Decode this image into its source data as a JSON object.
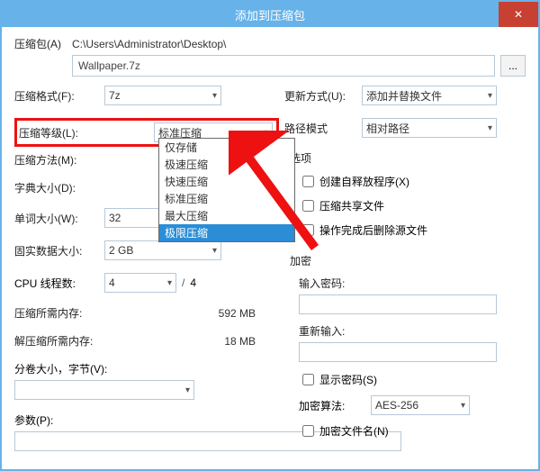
{
  "window": {
    "title": "添加到压缩包"
  },
  "archive": {
    "label": "压缩包(A)",
    "path": "C:\\Users\\Administrator\\Desktop\\",
    "file": "Wallpaper.7z",
    "browse": "..."
  },
  "left": {
    "format": {
      "label": "压缩格式(F):",
      "value": "7z"
    },
    "level": {
      "label": "压缩等级(L):",
      "value": "标准压缩",
      "options": [
        "仅存储",
        "极速压缩",
        "快速压缩",
        "标准压缩",
        "最大压缩",
        "极限压缩"
      ],
      "selected_index": 5
    },
    "method": {
      "label": "压缩方法(M):",
      "value": ""
    },
    "dict": {
      "label": "字典大小(D):",
      "value": ""
    },
    "word": {
      "label": "单词大小(W):",
      "value": "32"
    },
    "solid": {
      "label": "固实数据大小:",
      "value": "2 GB"
    },
    "cpu": {
      "label": "CPU 线程数:",
      "value": "4",
      "total": "4"
    },
    "mem_compress": {
      "label": "压缩所需内存:",
      "value": "592 MB"
    },
    "mem_decompress": {
      "label": "解压缩所需内存:",
      "value": "18 MB"
    },
    "split": {
      "label": "分卷大小，字节(V):",
      "value": ""
    },
    "params": {
      "label": "参数(P):",
      "value": ""
    }
  },
  "right": {
    "update": {
      "label": "更新方式(U):",
      "value": "添加并替换文件"
    },
    "pathmode": {
      "label": "路径模式",
      "value": "相对路径"
    },
    "options_title": "选项",
    "opt_sfx": {
      "label": "创建自释放程序(X)",
      "checked": false
    },
    "opt_share": {
      "label": "压缩共享文件",
      "checked": false
    },
    "opt_delete": {
      "label": "操作完成后删除源文件",
      "checked": false
    },
    "enc_title": "加密",
    "pw": {
      "label": "输入密码:",
      "value": ""
    },
    "pw2": {
      "label": "重新输入:",
      "value": ""
    },
    "showpw": {
      "label": "显示密码(S)",
      "checked": false
    },
    "algo": {
      "label": "加密算法:",
      "value": "AES-256"
    },
    "encnames": {
      "label": "加密文件名(N)",
      "checked": false
    }
  }
}
